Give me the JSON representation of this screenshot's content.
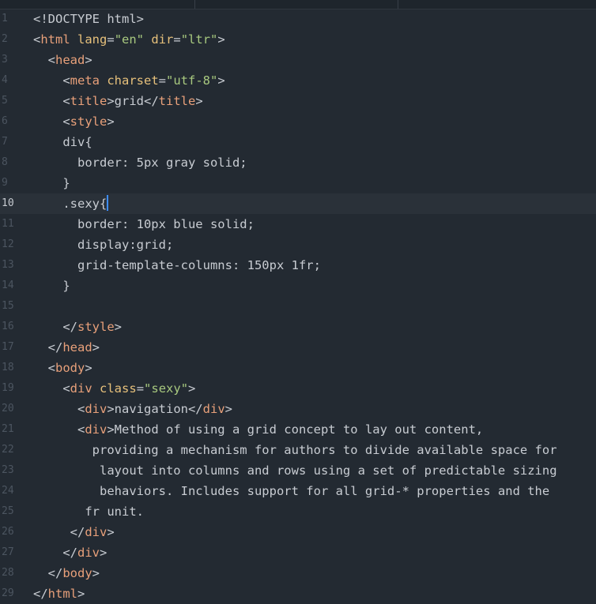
{
  "colors": {
    "background": "#232a32",
    "active_line": "#2a3139",
    "tag": "#e8a07a",
    "attribute": "#e6c07b",
    "string": "#a8c97f",
    "text": "#c8ccd2",
    "line_number": "#4c5560",
    "cursor": "#3d8dff"
  },
  "editor": {
    "active_line": 10,
    "lines": [
      {
        "n": "1",
        "tokens": [
          {
            "t": "text",
            "v": "<!DOCTYPE html>"
          }
        ]
      },
      {
        "n": "2",
        "tokens": [
          {
            "t": "text",
            "v": "<"
          },
          {
            "t": "tag",
            "v": "html"
          },
          {
            "t": "text",
            "v": " "
          },
          {
            "t": "attr",
            "v": "lang"
          },
          {
            "t": "text",
            "v": "="
          },
          {
            "t": "str",
            "v": "\"en\""
          },
          {
            "t": "text",
            "v": " "
          },
          {
            "t": "attr",
            "v": "dir"
          },
          {
            "t": "text",
            "v": "="
          },
          {
            "t": "str",
            "v": "\"ltr\""
          },
          {
            "t": "text",
            "v": ">"
          }
        ]
      },
      {
        "n": "3",
        "tokens": [
          {
            "t": "text",
            "v": "  <"
          },
          {
            "t": "tag",
            "v": "head"
          },
          {
            "t": "text",
            "v": ">"
          }
        ]
      },
      {
        "n": "4",
        "tokens": [
          {
            "t": "text",
            "v": "    <"
          },
          {
            "t": "tag",
            "v": "meta"
          },
          {
            "t": "text",
            "v": " "
          },
          {
            "t": "attr",
            "v": "charset"
          },
          {
            "t": "text",
            "v": "="
          },
          {
            "t": "str",
            "v": "\"utf-8\""
          },
          {
            "t": "text",
            "v": ">"
          }
        ]
      },
      {
        "n": "5",
        "tokens": [
          {
            "t": "text",
            "v": "    <"
          },
          {
            "t": "tag",
            "v": "title"
          },
          {
            "t": "text",
            "v": ">grid</"
          },
          {
            "t": "tag",
            "v": "title"
          },
          {
            "t": "text",
            "v": ">"
          }
        ]
      },
      {
        "n": "6",
        "tokens": [
          {
            "t": "text",
            "v": "    <"
          },
          {
            "t": "tag",
            "v": "style"
          },
          {
            "t": "text",
            "v": ">"
          }
        ]
      },
      {
        "n": "7",
        "tokens": [
          {
            "t": "text",
            "v": "    div{"
          }
        ]
      },
      {
        "n": "8",
        "tokens": [
          {
            "t": "text",
            "v": "      border: 5px gray solid;"
          }
        ]
      },
      {
        "n": "9",
        "tokens": [
          {
            "t": "text",
            "v": "    }"
          }
        ]
      },
      {
        "n": "10",
        "tokens": [
          {
            "t": "text",
            "v": "    .sexy{"
          }
        ],
        "cursor": true
      },
      {
        "n": "11",
        "tokens": [
          {
            "t": "text",
            "v": "      border: 10px blue solid;"
          }
        ]
      },
      {
        "n": "12",
        "tokens": [
          {
            "t": "text",
            "v": "      display:grid;"
          }
        ]
      },
      {
        "n": "13",
        "tokens": [
          {
            "t": "text",
            "v": "      grid-template-columns: 150px 1fr;"
          }
        ]
      },
      {
        "n": "14",
        "tokens": [
          {
            "t": "text",
            "v": "    }"
          }
        ]
      },
      {
        "n": "15",
        "tokens": []
      },
      {
        "n": "16",
        "tokens": [
          {
            "t": "text",
            "v": "    </"
          },
          {
            "t": "tag",
            "v": "style"
          },
          {
            "t": "text",
            "v": ">"
          }
        ]
      },
      {
        "n": "17",
        "tokens": [
          {
            "t": "text",
            "v": "  </"
          },
          {
            "t": "tag",
            "v": "head"
          },
          {
            "t": "text",
            "v": ">"
          }
        ]
      },
      {
        "n": "18",
        "tokens": [
          {
            "t": "text",
            "v": "  <"
          },
          {
            "t": "tag",
            "v": "body"
          },
          {
            "t": "text",
            "v": ">"
          }
        ]
      },
      {
        "n": "19",
        "tokens": [
          {
            "t": "text",
            "v": "    <"
          },
          {
            "t": "tag",
            "v": "div"
          },
          {
            "t": "text",
            "v": " "
          },
          {
            "t": "attr",
            "v": "class"
          },
          {
            "t": "text",
            "v": "="
          },
          {
            "t": "str",
            "v": "\"sexy\""
          },
          {
            "t": "text",
            "v": ">"
          }
        ]
      },
      {
        "n": "20",
        "tokens": [
          {
            "t": "text",
            "v": "      <"
          },
          {
            "t": "tag",
            "v": "div"
          },
          {
            "t": "text",
            "v": ">navigation</"
          },
          {
            "t": "tag",
            "v": "div"
          },
          {
            "t": "text",
            "v": ">"
          }
        ]
      },
      {
        "n": "21",
        "tokens": [
          {
            "t": "text",
            "v": "      <"
          },
          {
            "t": "tag",
            "v": "div"
          },
          {
            "t": "text",
            "v": ">Method of using a grid concept to lay out content,"
          }
        ]
      },
      {
        "n": "22",
        "tokens": [
          {
            "t": "text",
            "v": "        providing a mechanism for authors to divide available space for"
          }
        ]
      },
      {
        "n": "23",
        "tokens": [
          {
            "t": "text",
            "v": "         layout into columns and rows using a set of predictable sizing"
          }
        ]
      },
      {
        "n": "24",
        "tokens": [
          {
            "t": "text",
            "v": "         behaviors. Includes support for all grid-* properties and the"
          }
        ]
      },
      {
        "n": "25",
        "tokens": [
          {
            "t": "text",
            "v": "       fr unit."
          }
        ]
      },
      {
        "n": "26",
        "tokens": [
          {
            "t": "text",
            "v": "     </"
          },
          {
            "t": "tag",
            "v": "div"
          },
          {
            "t": "text",
            "v": ">"
          }
        ]
      },
      {
        "n": "27",
        "tokens": [
          {
            "t": "text",
            "v": "    </"
          },
          {
            "t": "tag",
            "v": "div"
          },
          {
            "t": "text",
            "v": ">"
          }
        ]
      },
      {
        "n": "28",
        "tokens": [
          {
            "t": "text",
            "v": "  </"
          },
          {
            "t": "tag",
            "v": "body"
          },
          {
            "t": "text",
            "v": ">"
          }
        ]
      },
      {
        "n": "29",
        "tokens": [
          {
            "t": "text",
            "v": "</"
          },
          {
            "t": "tag",
            "v": "html"
          },
          {
            "t": "text",
            "v": ">"
          }
        ]
      }
    ]
  }
}
